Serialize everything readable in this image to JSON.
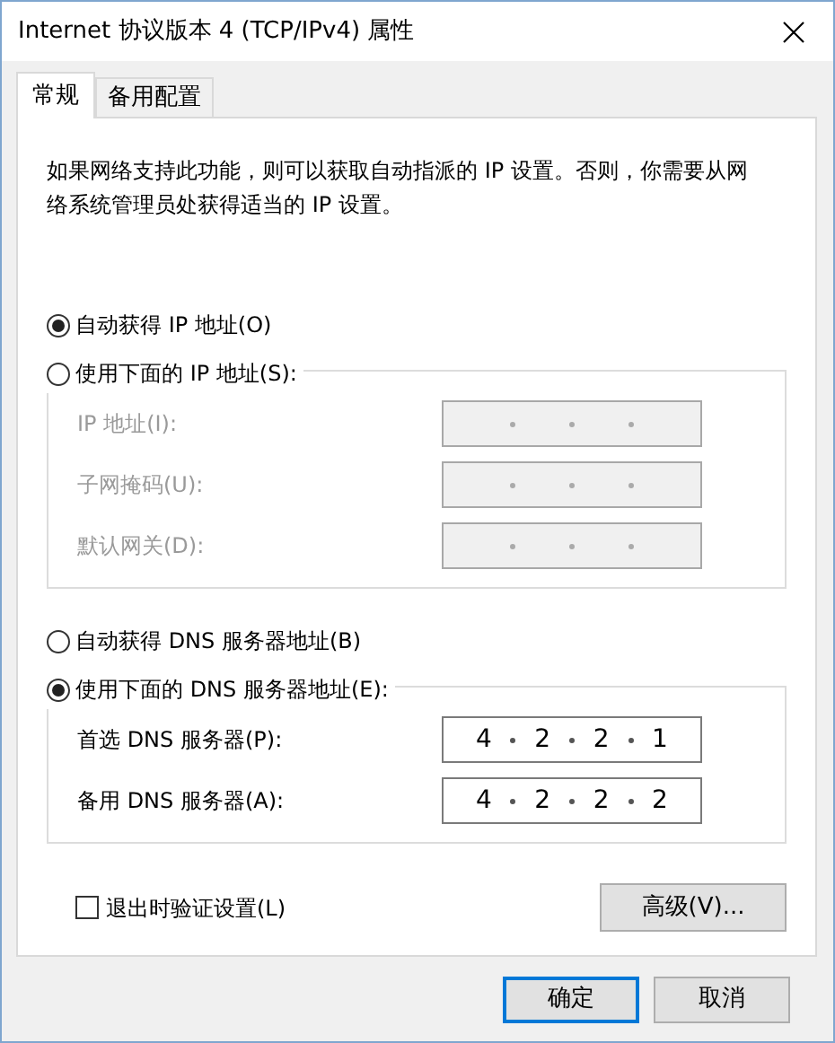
{
  "window": {
    "title": "Internet 协议版本 4 (TCP/IPv4) 属性"
  },
  "tabs": [
    {
      "label": "常规",
      "selected": true
    },
    {
      "label": "备用配置",
      "selected": false
    }
  ],
  "description": "如果网络支持此功能，则可以获取自动指派的 IP 设置。否则，你需要从网络系统管理员处获得适当的 IP 设置。",
  "ip_section": {
    "options": [
      {
        "label": "自动获得 IP 地址(O)",
        "selected": true
      },
      {
        "label": "使用下面的 IP 地址(S):",
        "selected": false
      }
    ],
    "fields": [
      {
        "label": "IP 地址(I):",
        "disabled": true
      },
      {
        "label": "子网掩码(U):",
        "disabled": true
      },
      {
        "label": "默认网关(D):",
        "disabled": true
      }
    ]
  },
  "dns_section": {
    "options": [
      {
        "label": "自动获得 DNS 服务器地址(B)",
        "selected": false
      },
      {
        "label": "使用下面的 DNS 服务器地址(E):",
        "selected": true
      }
    ],
    "fields": [
      {
        "label": "首选 DNS 服务器(P):",
        "disabled": false,
        "octets": [
          "4",
          "2",
          "2",
          "1"
        ]
      },
      {
        "label": "备用 DNS 服务器(A):",
        "disabled": false,
        "octets": [
          "4",
          "2",
          "2",
          "2"
        ]
      }
    ]
  },
  "validate_checkbox": {
    "label": "退出时验证设置(L)",
    "checked": false
  },
  "advanced_button": "高级(V)...",
  "buttons": [
    {
      "label": "确定",
      "default": true
    },
    {
      "label": "取消",
      "default": false
    }
  ]
}
